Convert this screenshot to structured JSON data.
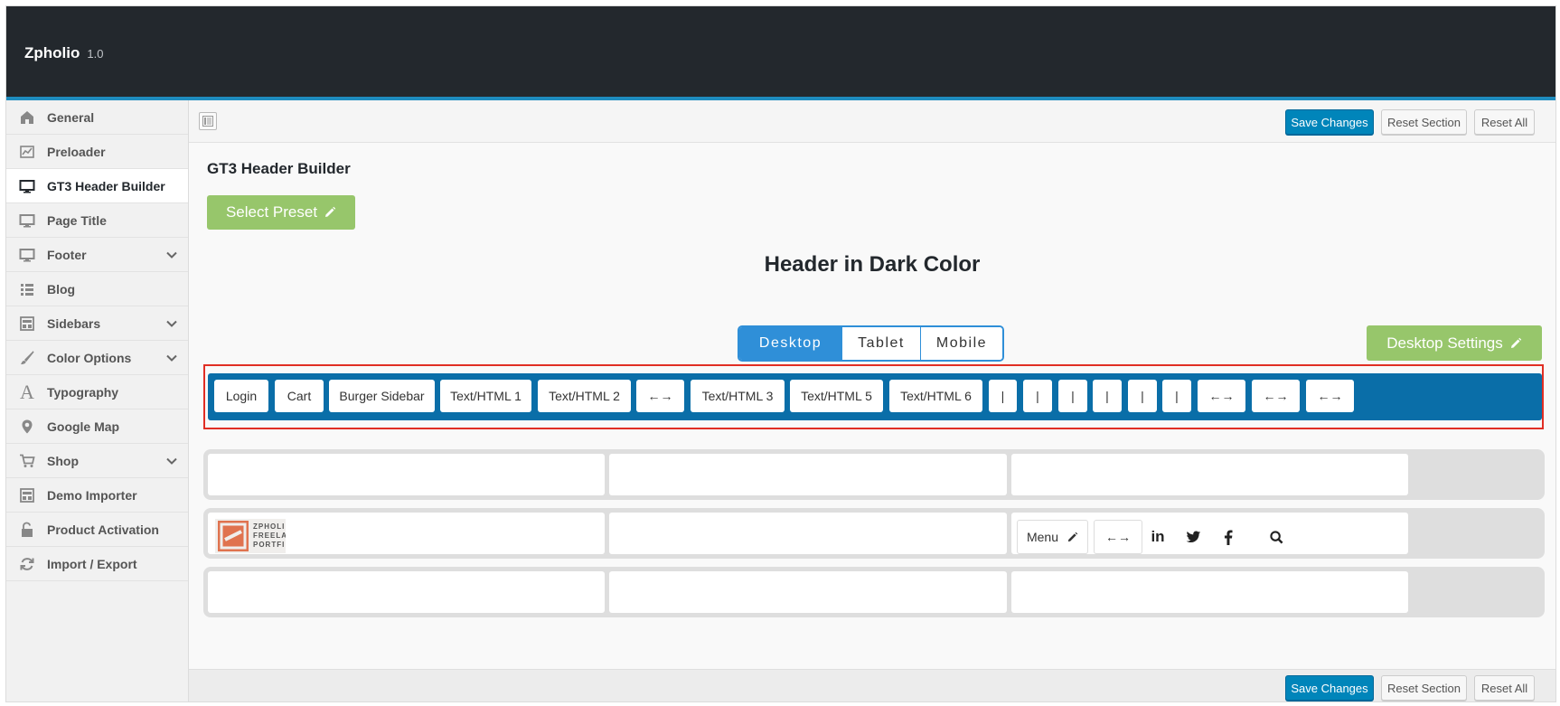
{
  "brand": {
    "name": "Zpholio",
    "version": "1.0"
  },
  "sidebar": {
    "items": [
      {
        "label": "General",
        "icon": "home-icon"
      },
      {
        "label": "Preloader",
        "icon": "chart-icon"
      },
      {
        "label": "GT3 Header Builder",
        "icon": "monitor-icon",
        "active": true
      },
      {
        "label": "Page Title",
        "icon": "monitor-icon"
      },
      {
        "label": "Footer",
        "icon": "monitor-icon",
        "expandable": true
      },
      {
        "label": "Blog",
        "icon": "list-icon"
      },
      {
        "label": "Sidebars",
        "icon": "layout-icon",
        "expandable": true
      },
      {
        "label": "Color Options",
        "icon": "brush-icon",
        "expandable": true
      },
      {
        "label": "Typography",
        "icon": "typography-icon"
      },
      {
        "label": "Google Map",
        "icon": "map-pin-icon"
      },
      {
        "label": "Shop",
        "icon": "cart-icon",
        "expandable": true
      },
      {
        "label": "Demo Importer",
        "icon": "layout-icon"
      },
      {
        "label": "Product Activation",
        "icon": "unlock-icon"
      },
      {
        "label": "Import / Export",
        "icon": "refresh-icon"
      }
    ]
  },
  "toolbar": {
    "save": "Save Changes",
    "reset_section": "Reset Section",
    "reset_all": "Reset All"
  },
  "section": {
    "title": "GT3 Header Builder",
    "select_preset": "Select Preset",
    "preset_name": "Header in Dark Color",
    "devices": [
      "Desktop",
      "Tablet",
      "Mobile"
    ],
    "active_device": "Desktop",
    "device_settings": "Desktop Settings"
  },
  "pool": {
    "items": [
      "Login",
      "Cart",
      "Burger Sidebar",
      "Text/HTML 1",
      "Text/HTML 2",
      "←→",
      "Text/HTML 3",
      "Text/HTML 5",
      "Text/HTML 6",
      "|",
      "|",
      "|",
      "|",
      "|",
      "|",
      "←→",
      "←→",
      "←→"
    ]
  },
  "builder": {
    "logo_text": [
      "ZPHOLI",
      "FREELA",
      "PORTFI"
    ],
    "menu_label": "Menu",
    "spacer": "←→",
    "social": [
      "linkedin-icon",
      "twitter-icon",
      "facebook-icon",
      "search-icon"
    ]
  },
  "colors": {
    "accent": "#0085ba",
    "topbar": "#23282d",
    "green": "#97c66b",
    "pool": "#0a6ea8",
    "highlight": "#e02e24"
  }
}
